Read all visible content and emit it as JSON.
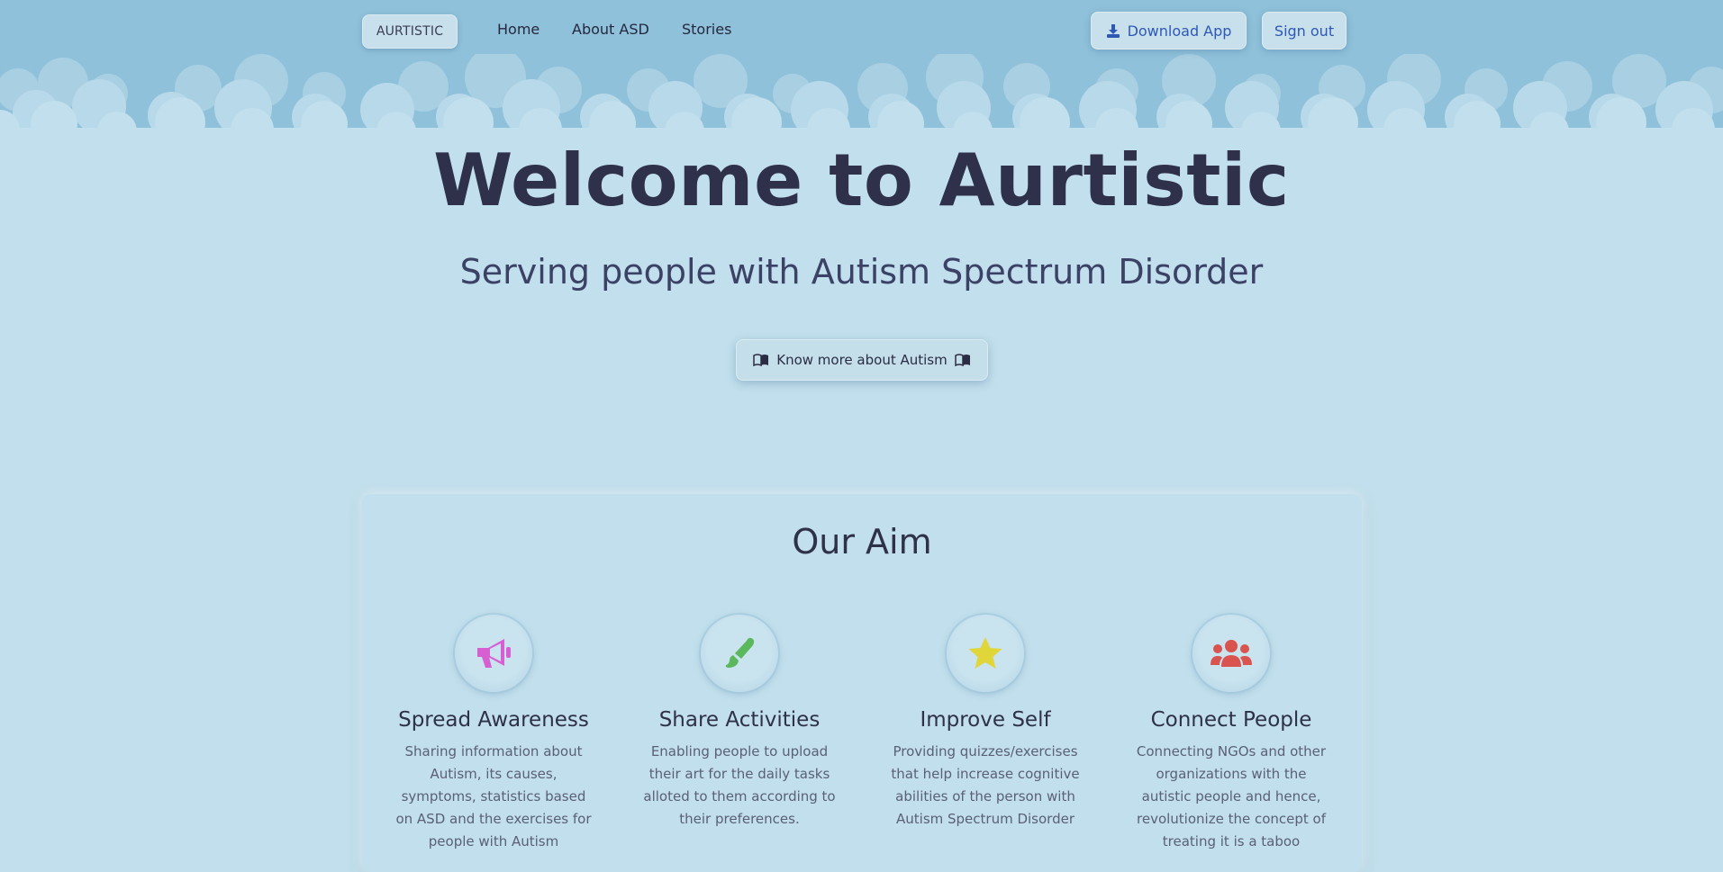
{
  "nav": {
    "brand": "AURTISTIC",
    "links": [
      "Home",
      "About ASD",
      "Stories"
    ],
    "download_label": "Download App",
    "signout_label": "Sign out"
  },
  "hero": {
    "title": "Welcome to Aurtistic",
    "subtitle": "Serving people with Autism Spectrum Disorder",
    "cta_label": "Know more about Autism"
  },
  "aim": {
    "title": "Our Aim",
    "features": [
      {
        "title": "Spread Awareness",
        "desc": "Sharing information about Autism, its causes, symptoms, statistics based on ASD and the exercises for people with Autism",
        "icon": "megaphone-icon",
        "color": "#d65fd2"
      },
      {
        "title": "Share Activities",
        "desc": "Enabling people to upload their art for the daily tasks alloted to them according to their preferences.",
        "icon": "paintbrush-icon",
        "color": "#5cb85c"
      },
      {
        "title": "Improve Self",
        "desc": "Providing quizzes/exercises that help increase cognitive abilities of the person with Autism Spectrum Disorder",
        "icon": "star-icon",
        "color": "#e0d63a"
      },
      {
        "title": "Connect People",
        "desc": "Connecting NGOs and other organizations with the autistic people and hence, revolutionize the concept of treating it is a taboo",
        "icon": "users-icon",
        "color": "#d9534f"
      }
    ]
  },
  "colors": {
    "sky": "#8fc1da",
    "background": "#c1dfec",
    "text_dark": "#2f3049",
    "link_blue": "#2f58b5"
  }
}
